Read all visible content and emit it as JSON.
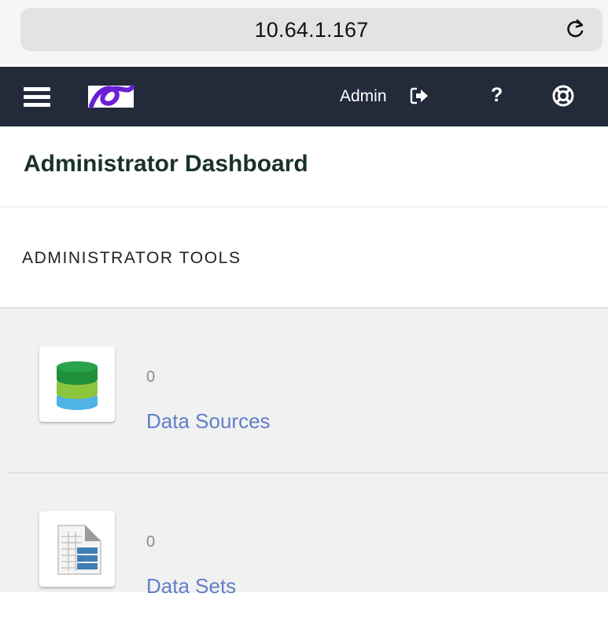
{
  "browser": {
    "url": "10.64.1.167"
  },
  "navbar": {
    "user_label": "Admin",
    "help_label": "?"
  },
  "page": {
    "title": "Administrator Dashboard",
    "section_heading": "ADMINISTRATOR TOOLS"
  },
  "tools": [
    {
      "count": "0",
      "label": "Data Sources",
      "icon": "database-icon"
    },
    {
      "count": "0",
      "label": "Data Sets",
      "icon": "dataset-icon"
    }
  ],
  "colors": {
    "navbar": "#232b3b",
    "title": "#19312a",
    "link": "#5f7fc6",
    "logo": "#6a1fd6"
  }
}
